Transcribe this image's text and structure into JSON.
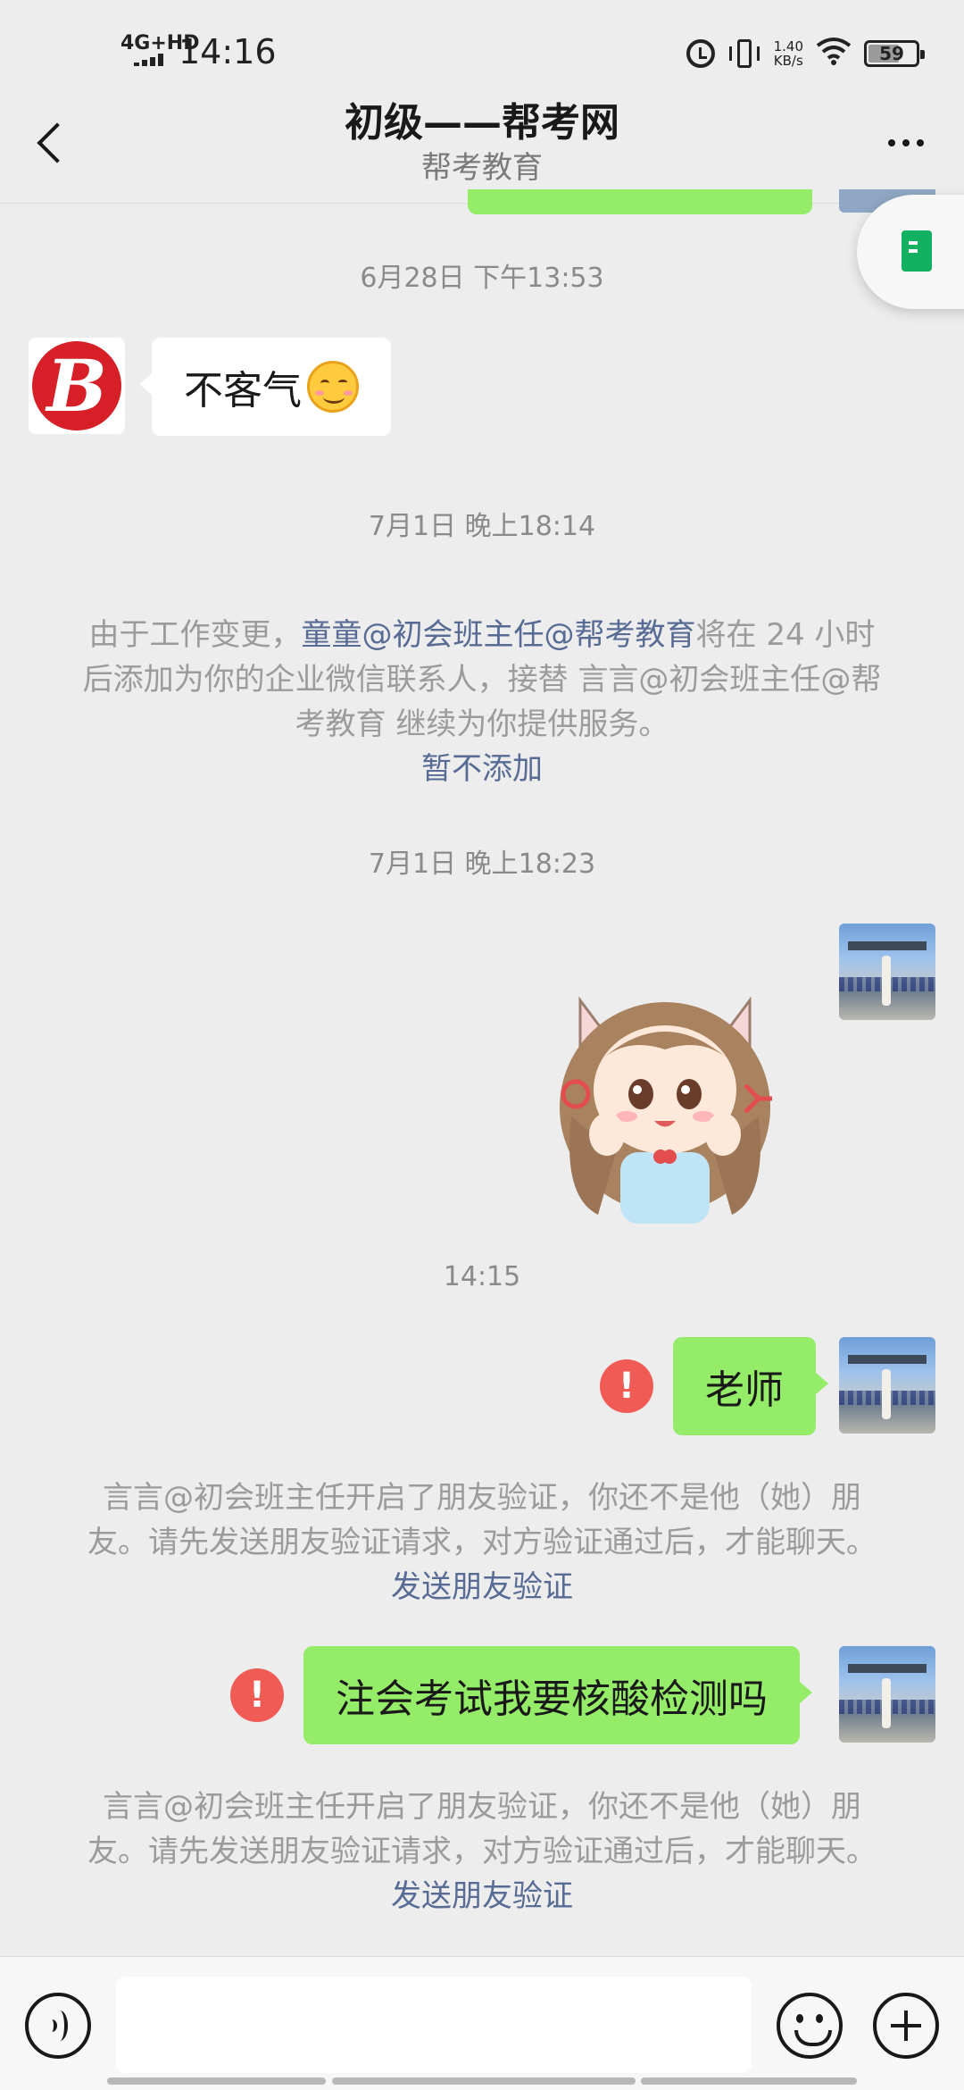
{
  "status_bar": {
    "network": "4G+HD",
    "time": "14:16",
    "net_speed_value": "1.40",
    "net_speed_unit": "KB/s",
    "battery": "59",
    "icons": [
      "signal-icon",
      "alarm-icon",
      "vibrate-icon",
      "wifi-icon",
      "battery-icon"
    ]
  },
  "header": {
    "title": "初级——帮考网",
    "subtitle": "帮考教育"
  },
  "messages": {
    "time_1": "6月28日 下午13:53",
    "incoming_text": "不客气",
    "incoming_avatar_letter": "B",
    "time_2": "7月1日 晚上18:14",
    "notice_1": {
      "prefix": "由于工作变更，",
      "link_name": "童童@初会班主任@帮考教育",
      "middle": "将在 24 小时后添加为你的企业微信联系人，接替 言言@初会班主任@帮考教育 继续为你提供服务。",
      "action": "暂不添加"
    },
    "time_3": "7月1日 晚上18:23",
    "time_4": "14:15",
    "outgoing_1": "老师",
    "notice_2": {
      "text": "言言@初会班主任开启了朋友验证，你还不是他（她）朋友。请先发送朋友验证请求，对方验证通过后，才能聊天。",
      "action": "发送朋友验证"
    },
    "outgoing_2": "注会考试我要核酸检测吗",
    "notice_3": {
      "text": "言言@初会班主任开启了朋友验证，你还不是他（她）朋友。请先发送朋友验证请求，对方验证通过后，才能聊天。",
      "action": "发送朋友验证"
    },
    "error_mark": "!"
  },
  "input_bar": {
    "placeholder": "",
    "icons": [
      "voice-icon",
      "emoji-icon",
      "plus-icon"
    ]
  },
  "colors": {
    "background": "#ededed",
    "outgoing_bubble": "#95ec69",
    "incoming_bubble": "#ffffff",
    "link": "#576b95",
    "error": "#f05b55",
    "system_text": "#9b9b9b",
    "brand_red": "#d71f27",
    "doc_green": "#12b161"
  }
}
